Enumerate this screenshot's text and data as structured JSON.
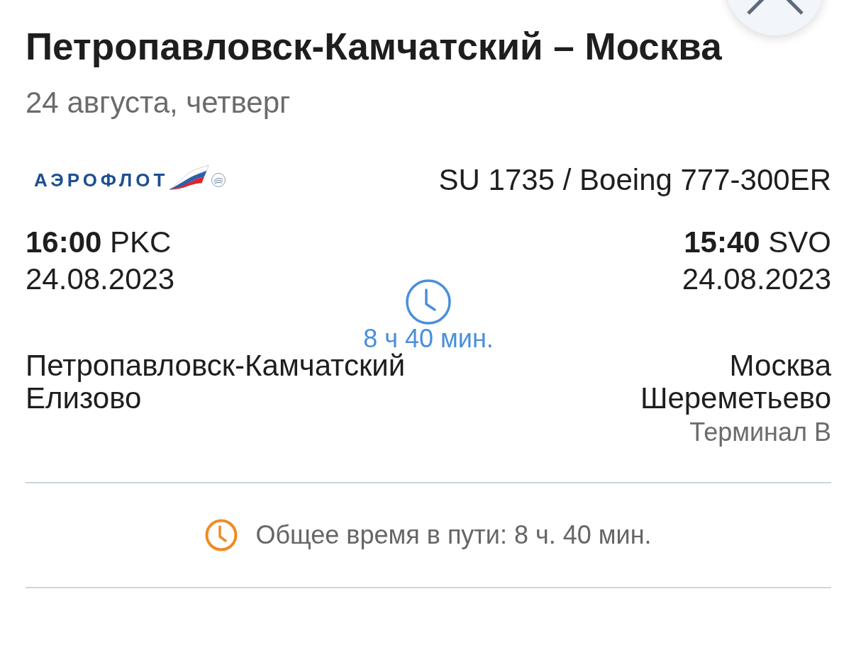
{
  "header": {
    "title": "Петропавловск-Камчатский – Москва",
    "date": "24 августа, четверг"
  },
  "flight": {
    "airline_logo": "АЭРОФЛОТ",
    "flight_info": "SU 1735 / Boeing 777-300ER"
  },
  "departure": {
    "time": "16:00",
    "airport_code": "PKC",
    "date": "24.08.2023",
    "city": "Петропавловск-Камчатский",
    "airport": "Елизово"
  },
  "duration": "8 ч 40 мин.",
  "arrival": {
    "time": "15:40",
    "airport_code": "SVO",
    "date": "24.08.2023",
    "city": "Москва",
    "airport": "Шереметьево",
    "terminal": "Терминал B"
  },
  "total": {
    "text": "Общее время в пути: 8 ч. 40 мин."
  }
}
